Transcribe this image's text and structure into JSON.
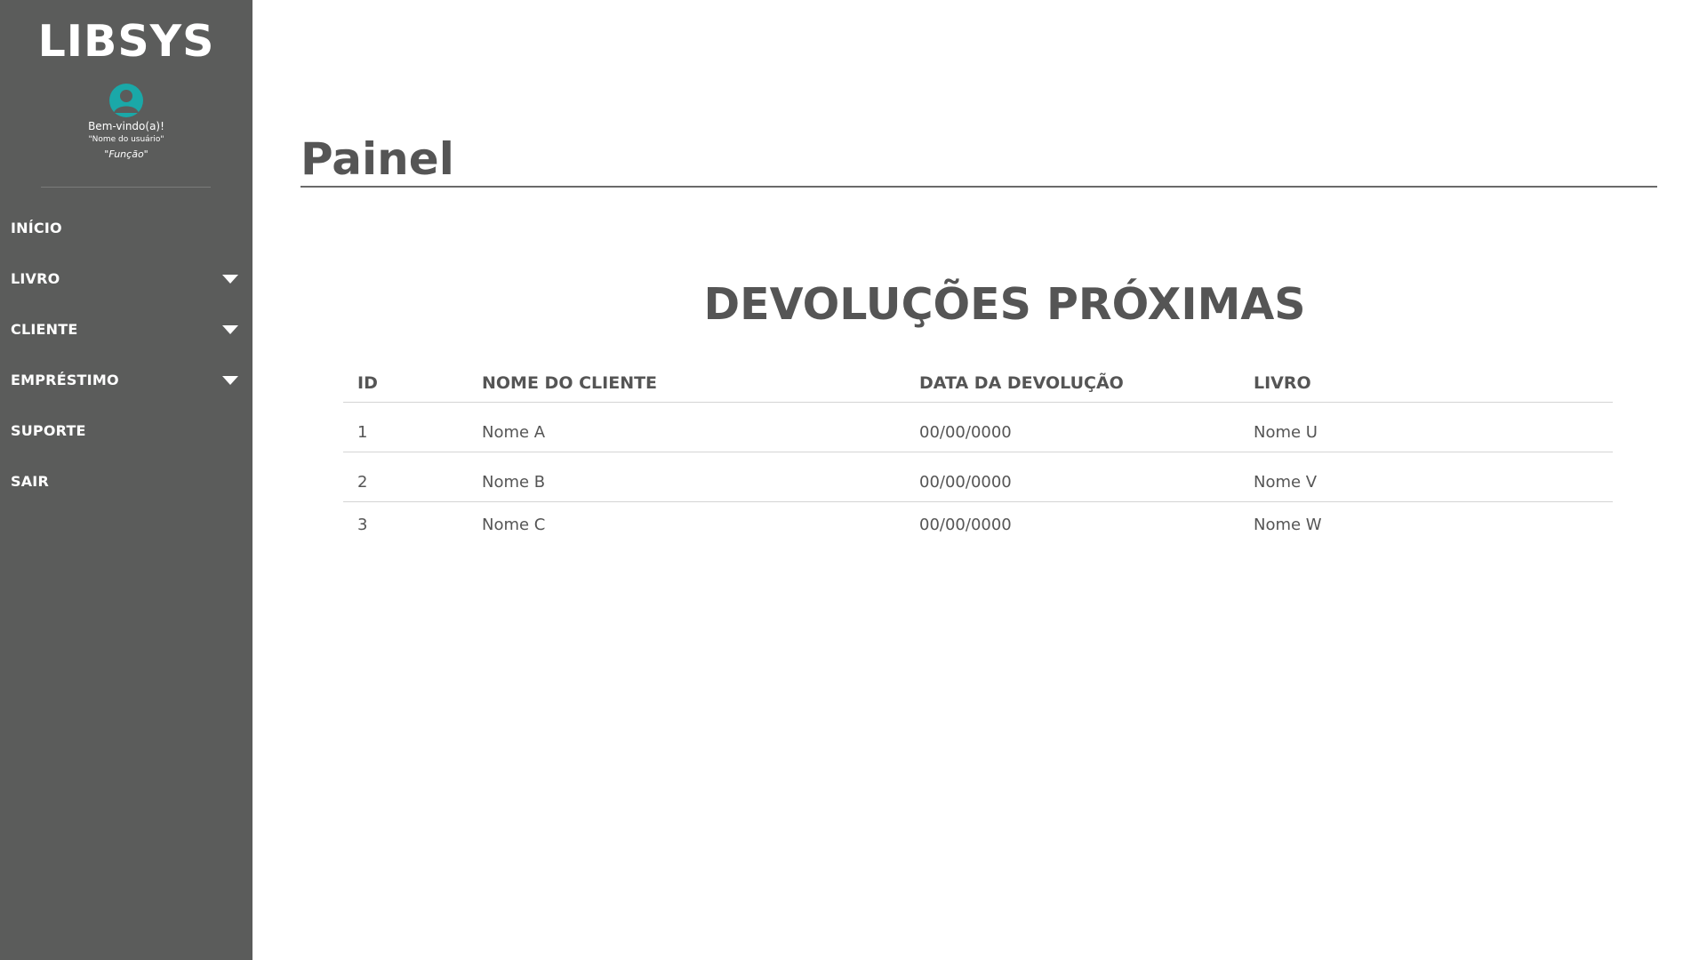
{
  "sidebar": {
    "logo": "LIBSYS",
    "welcome": "Bem-vindo(a)!",
    "username": "\"Nome do usuário\"",
    "role": "\"Função\"",
    "items": [
      {
        "label": "INÍCIO",
        "has_dropdown": false
      },
      {
        "label": "LIVRO",
        "has_dropdown": true
      },
      {
        "label": "CLIENTE",
        "has_dropdown": true
      },
      {
        "label": "EMPRÉSTIMO",
        "has_dropdown": true
      },
      {
        "label": "SUPORTE",
        "has_dropdown": false
      },
      {
        "label": "SAIR",
        "has_dropdown": false
      }
    ],
    "avatar_color": "#1aa8a8",
    "background": "#5b5c5b"
  },
  "main": {
    "page_title": "Painel",
    "section_title": "DEVOLUÇÕES PRÓXIMAS",
    "table": {
      "headers": [
        "ID",
        "NOME DO CLIENTE",
        "DATA DA DEVOLUÇÃO",
        "LIVRO"
      ],
      "rows": [
        [
          "1",
          "Nome A",
          "00/00/0000",
          "Nome U"
        ],
        [
          "2",
          "Nome B",
          "00/00/0000",
          "Nome V"
        ],
        [
          "3",
          "Nome C",
          "00/00/0000",
          "Nome W"
        ]
      ]
    }
  }
}
